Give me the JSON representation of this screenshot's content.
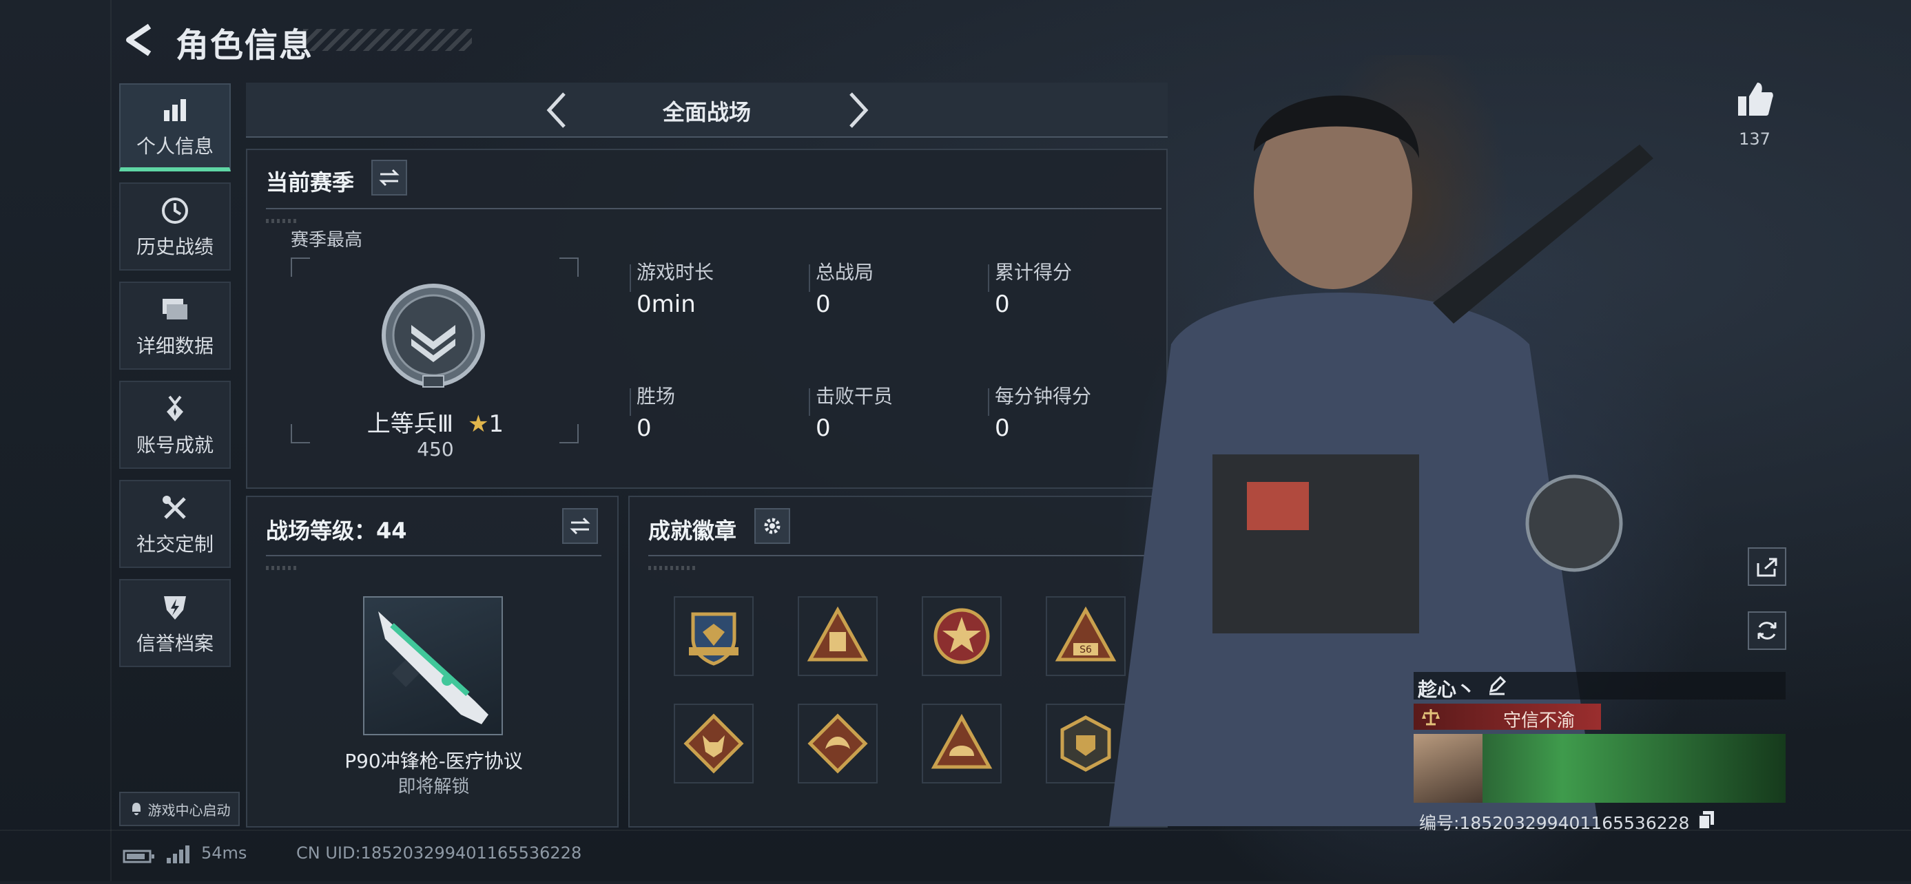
{
  "header": {
    "title": "角色信息"
  },
  "nav": {
    "items": [
      {
        "label": "个人信息",
        "icon": "bar-chart-icon",
        "active": true
      },
      {
        "label": "历史战绩",
        "icon": "history-clock-icon"
      },
      {
        "label": "详细数据",
        "icon": "folder-icon"
      },
      {
        "label": "账号成就",
        "icon": "medal-icon"
      },
      {
        "label": "社交定制",
        "icon": "tools-icon"
      },
      {
        "label": "信誉档案",
        "icon": "shield-bolt-icon"
      }
    ],
    "game_center": "游戏中心启动"
  },
  "mode": {
    "title": "全面战场"
  },
  "season": {
    "section_title": "当前赛季",
    "best_label": "赛季最高",
    "rank_name": "上等兵Ⅲ",
    "rank_stars": "1",
    "rank_score": "450",
    "stats": [
      {
        "label": "游戏时长",
        "value": "0min"
      },
      {
        "label": "总战局",
        "value": "0"
      },
      {
        "label": "累计得分",
        "value": "0"
      },
      {
        "label": "胜场",
        "value": "0"
      },
      {
        "label": "击败干员",
        "value": "0"
      },
      {
        "label": "每分钟得分",
        "value": "0"
      }
    ]
  },
  "level": {
    "title": "战场等级：44",
    "weapon_name": "P90冲锋枪-医疗协议",
    "weapon_status": "即将解锁"
  },
  "badges": {
    "title": "成就徽章",
    "items": [
      "eagle-shield-badge",
      "bag-triangle-badge",
      "star-emblem-badge",
      "s6-triangle-badge",
      "wolf-diamond-badge",
      "dragon-diamond-badge",
      "helmet-triangle-badge",
      "shield-hexagon-badge"
    ],
    "s6_text": "S6"
  },
  "profile": {
    "likes": "137",
    "player_name": "趁心丶",
    "title_tag": "守信不渝",
    "player_id": "编号:18520329940116553622​8"
  },
  "status": {
    "ping": "54ms",
    "uid": "CN UID:18520329940116553622​8"
  },
  "colors": {
    "accent": "#5fd6a5",
    "panel_border": "#36404c",
    "title_tag_bg": "#8a2424"
  }
}
